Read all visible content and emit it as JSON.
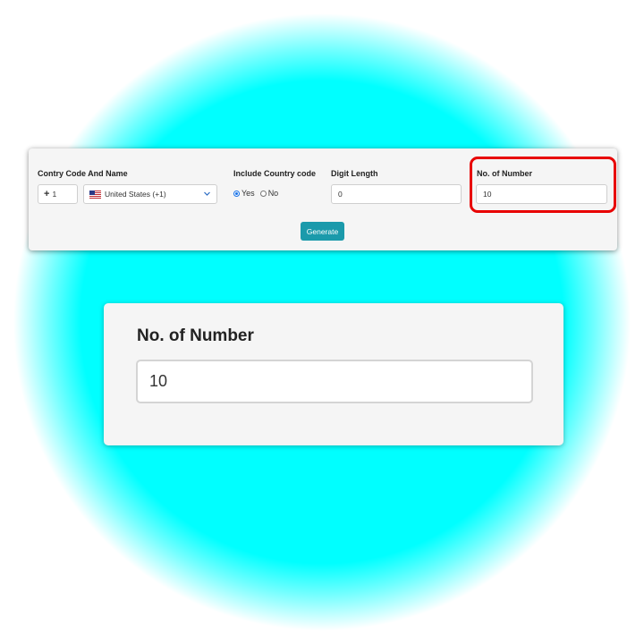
{
  "form": {
    "country": {
      "label": "Contry Code And Name",
      "code_prefix": "+",
      "code_value": "1",
      "selected": "United States (+1)",
      "flag_icon": "us-flag-icon"
    },
    "include_code": {
      "label": "Include Country code",
      "options": [
        "Yes",
        "No"
      ],
      "selected": "Yes"
    },
    "digit_length": {
      "label": "Digit Length",
      "value": "0"
    },
    "num_numbers": {
      "label": "No. of Number",
      "value": "10"
    },
    "generate_label": "Generate"
  },
  "zoom": {
    "label": "No. of Number",
    "value": "10"
  },
  "colors": {
    "glow": "#00ffff",
    "highlight": "#e80000",
    "button": "#1b9aab",
    "radio_accent": "#1a73e8"
  }
}
